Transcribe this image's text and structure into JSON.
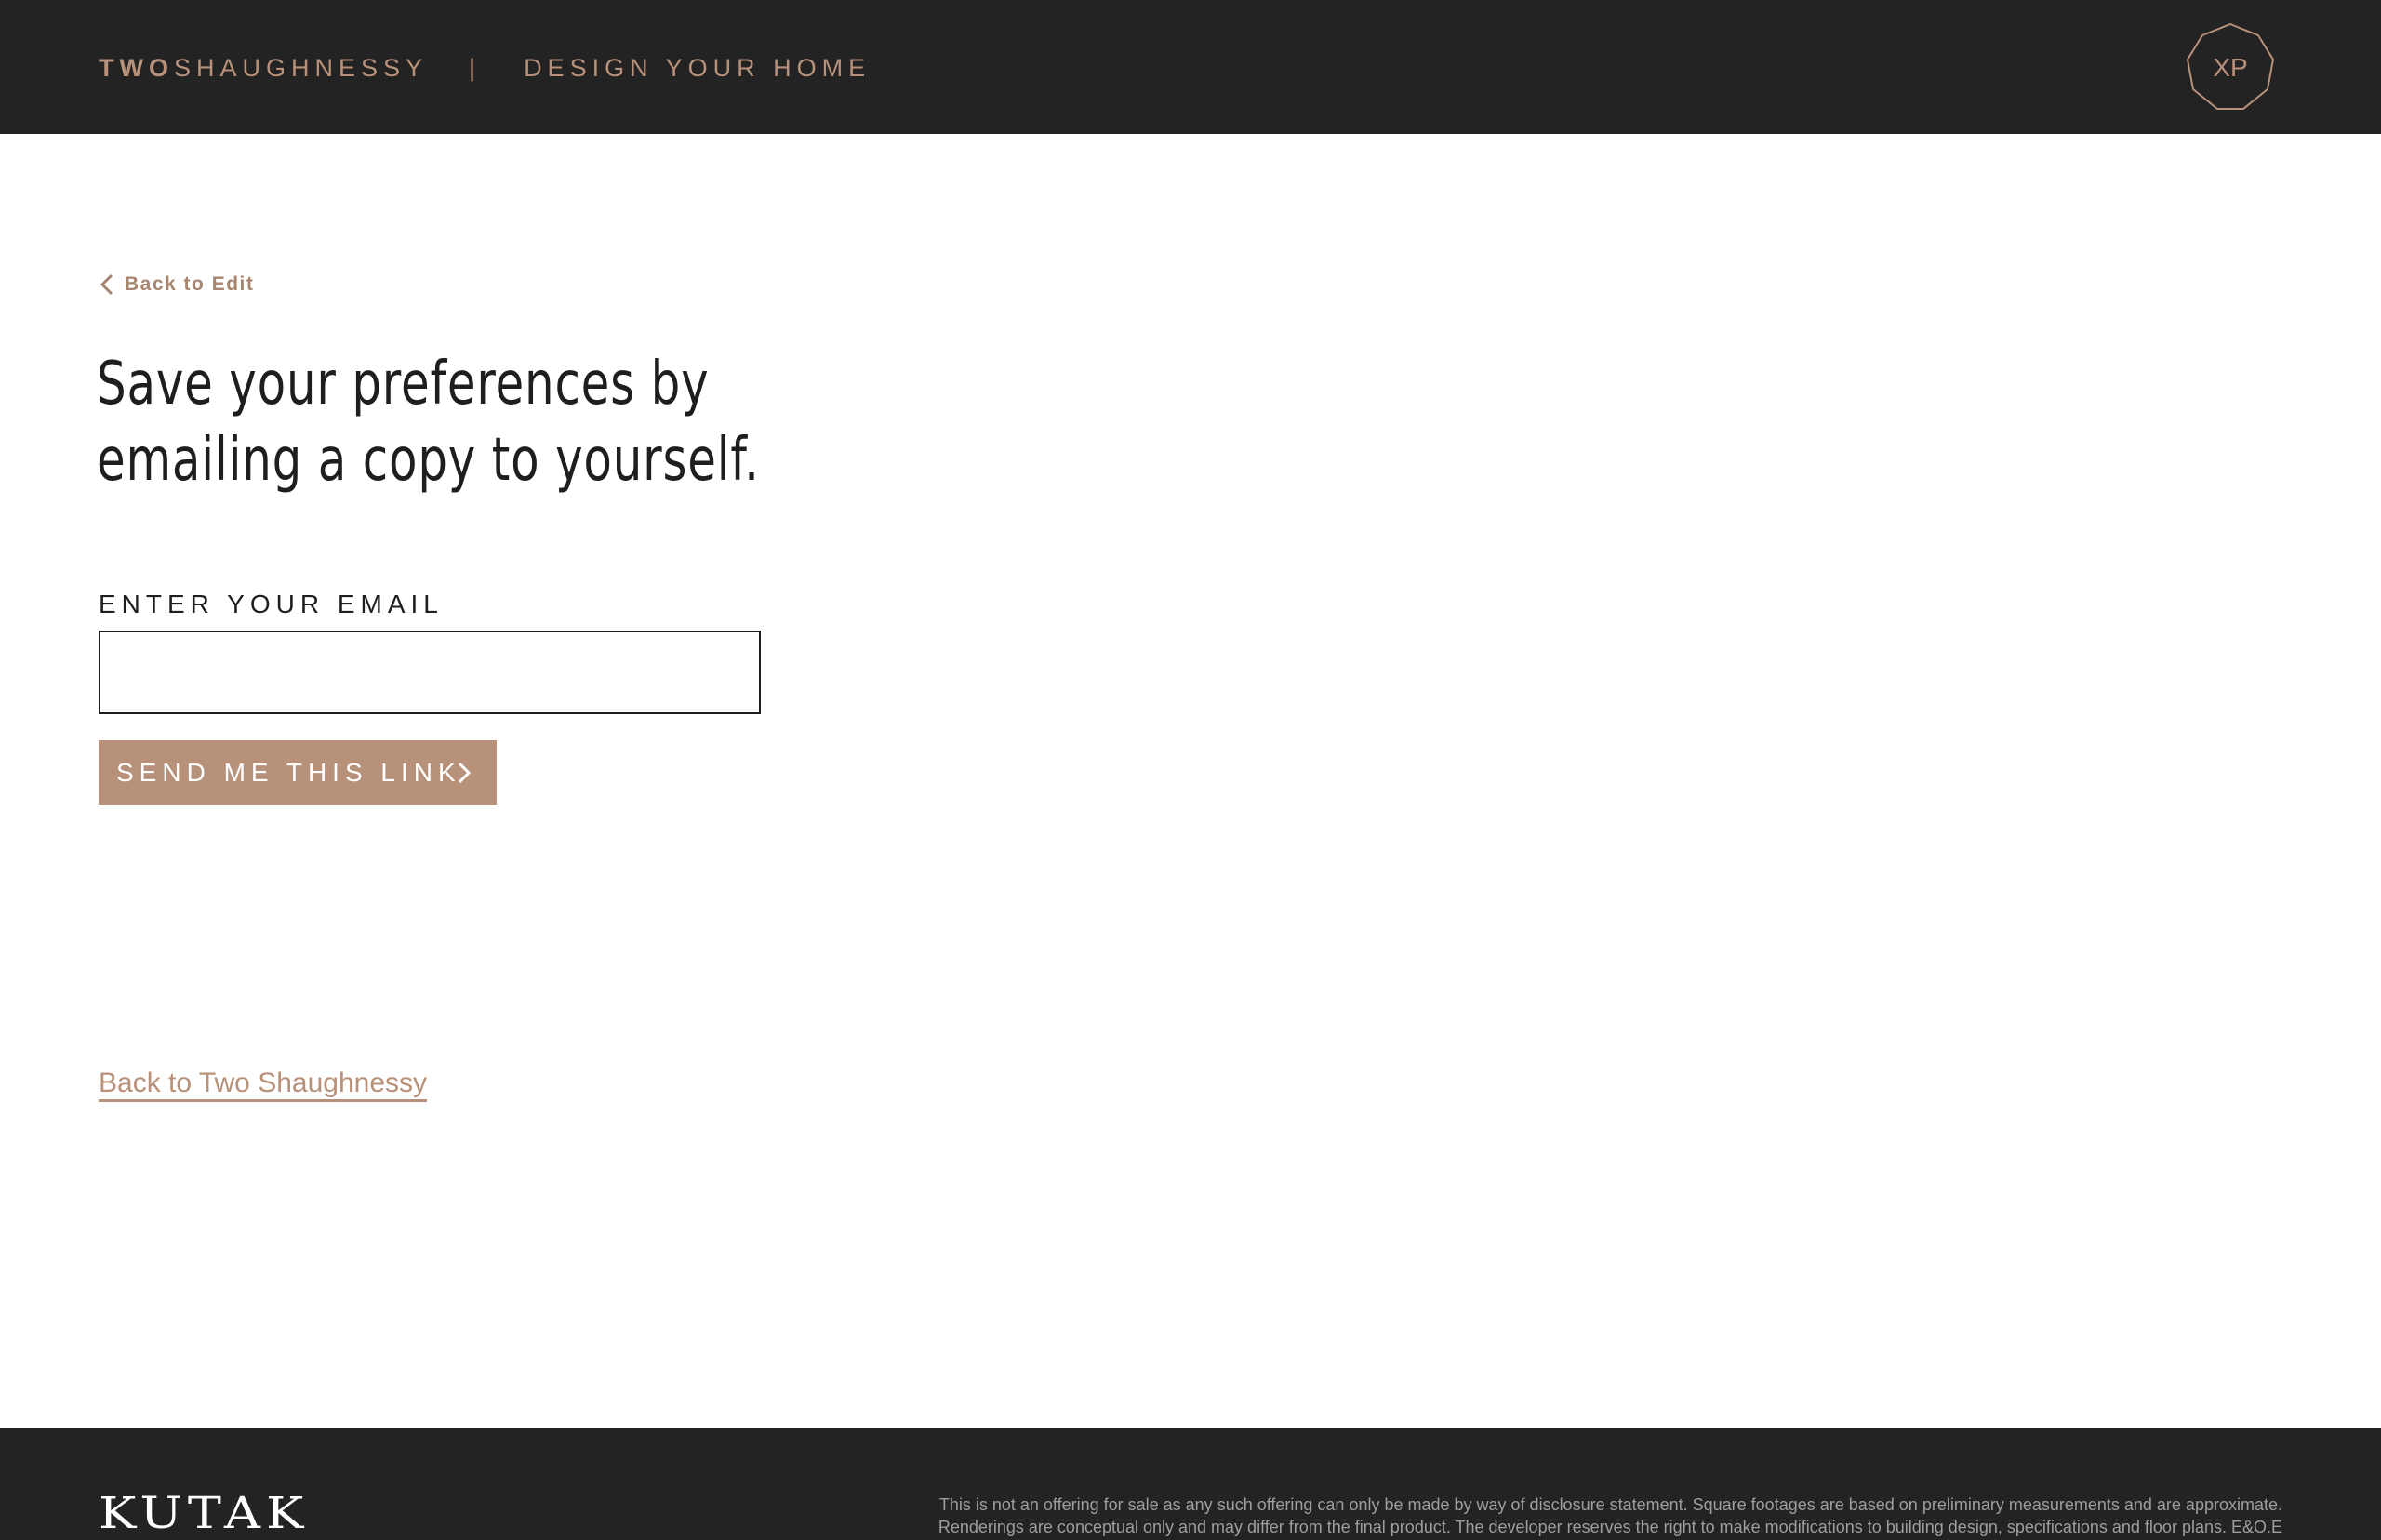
{
  "header": {
    "brand_bold": "TWO",
    "brand_regular": "SHAUGHNESSY",
    "divider": "|",
    "section_title": "DESIGN YOUR HOME",
    "badge_text": "XP"
  },
  "main": {
    "back_link": "Back to Edit",
    "heading_line1": "Save your preferences by",
    "heading_line2": "emailing a copy to yourself.",
    "email_label": "ENTER YOUR EMAIL",
    "email_value": "",
    "email_placeholder": "",
    "send_button": "SEND ME THIS LINK",
    "back_home_link": "Back to Two Shaughnessy"
  },
  "footer": {
    "logo": "KUTAK",
    "disclaimer_line1": "This is not an offering for sale as any such offering can only be made by way of disclosure statement. Square footages are based on preliminary measurements and are approximate.",
    "disclaimer_line2": "Renderings are conceptual only and may differ from the final product. The developer reserves the right to make modifications to building design, specifications and floor plans. E&O.E"
  },
  "colors": {
    "bar_background": "#232323",
    "accent": "#b8917a",
    "text_dark": "#1e1e1e"
  },
  "icons": {
    "back": "chevron-left-icon",
    "send": "chevron-right-icon",
    "badge": "xp-octagon-logo"
  }
}
